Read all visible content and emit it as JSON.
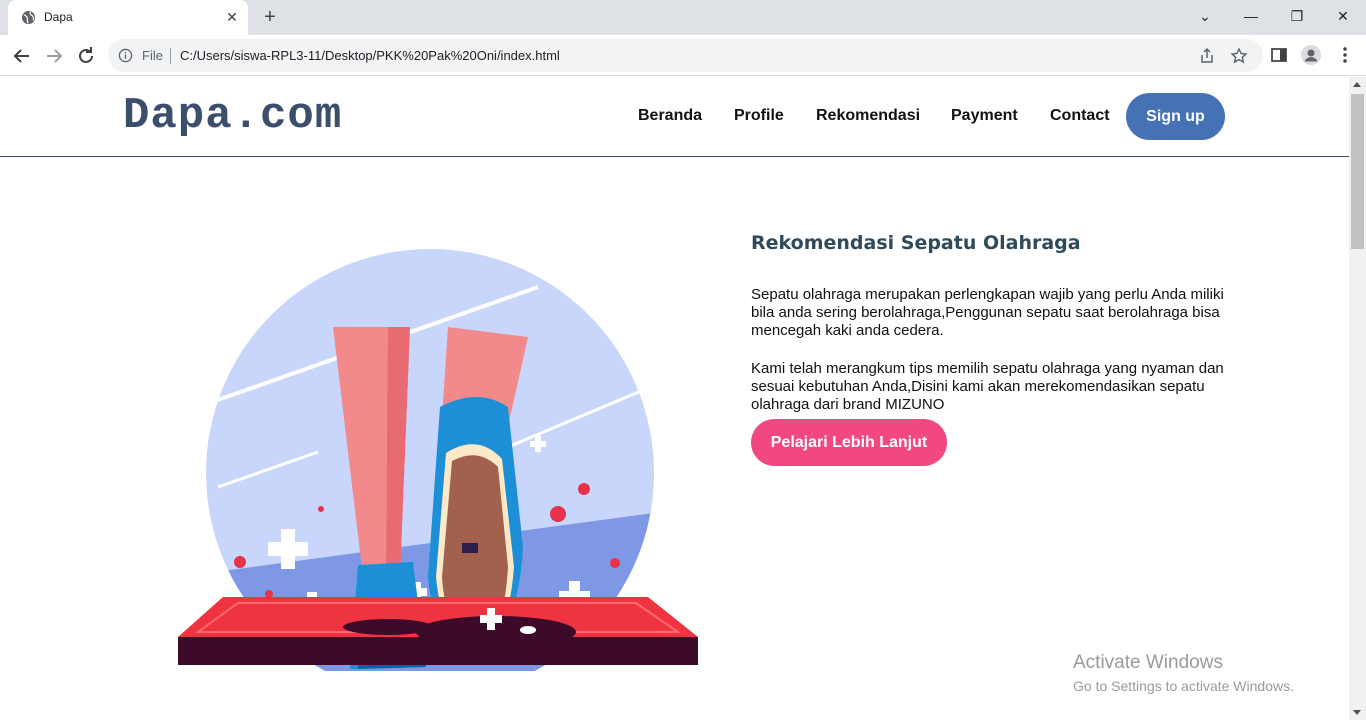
{
  "browser": {
    "tab_title": "Dapa",
    "tab_close": "✕",
    "new_tab": "+",
    "window_controls": {
      "dropdown": "⌄",
      "minimize": "—",
      "restore": "❐",
      "close": "✕"
    },
    "omnibox": {
      "file_label": "File",
      "url": "C:/Users/siswa-RPL3-11/Desktop/PKK%20Pak%20Oni/index.html"
    }
  },
  "site": {
    "logo": "Dapa.com",
    "nav": [
      "Beranda",
      "Profile",
      "Rekomendasi",
      "Payment",
      "Contact"
    ],
    "signup_label": "Sign up"
  },
  "hero": {
    "title": "Rekomendasi Sepatu Olahraga",
    "paragraph_1": "Sepatu olahraga merupakan perlengkapan wajib yang perlu Anda miliki bila anda sering berolahraga,Penggunan sepatu saat berolahraga bisa mencegah kaki anda cedera.",
    "paragraph_2": "Kami telah merangkum tips memilih sepatu olahraga yang nyaman dan sesuai kebutuhan Anda,Disini kami akan merekomendasikan sepatu olahraga dari brand MIZUNO",
    "cta_label": "Pelajari Lebih Lanjut"
  },
  "watermark": {
    "line_1": "Activate Windows",
    "line_2": "Go to Settings to activate Windows."
  },
  "colors": {
    "logo": "#3b4f6d",
    "signup_bg": "#4472b4",
    "cta_bg": "#f0487f",
    "title": "#2f4a5a"
  }
}
